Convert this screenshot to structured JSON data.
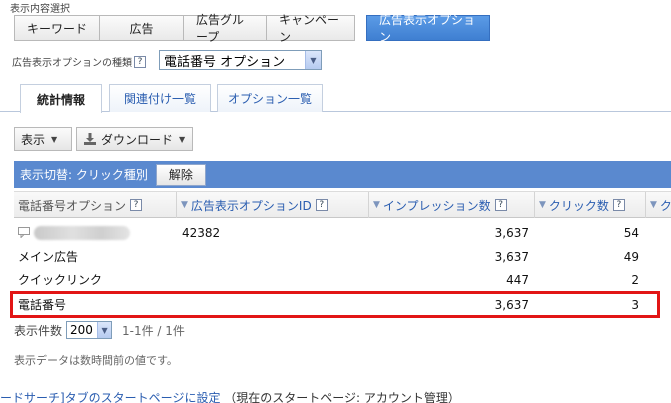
{
  "section_label": "表示内容選択",
  "segments": [
    {
      "label": "キーワード"
    },
    {
      "label": "広告"
    },
    {
      "label": "広告グループ"
    },
    {
      "label": "キャンペーン"
    },
    {
      "label": "広告表示オプション",
      "active": true
    }
  ],
  "type_selector": {
    "label": "広告表示オプションの種類",
    "help": "?",
    "value": "電話番号 オプション"
  },
  "tabs": [
    {
      "label": "統計情報",
      "active": true
    },
    {
      "label": "関連付け一覧"
    },
    {
      "label": "オプション一覧"
    }
  ],
  "toolbar": {
    "view_label": "表示",
    "download_label": "ダウンロード"
  },
  "filter_bar": {
    "label": "表示切替: クリック種別",
    "clear_label": "解除"
  },
  "table": {
    "columns": [
      {
        "label": "電話番号オプション",
        "help": "?"
      },
      {
        "label": "広告表示オプションID",
        "help": "?"
      },
      {
        "label": "インプレッション数",
        "help": "?"
      },
      {
        "label": "クリック数",
        "help": "?"
      },
      {
        "label": "ク"
      }
    ],
    "rows": [
      {
        "name": "",
        "id": "42382",
        "impressions": "3,637",
        "clicks": "54"
      },
      {
        "name": "メイン広告",
        "id": "",
        "impressions": "3,637",
        "clicks": "49"
      },
      {
        "name": "クイックリンク",
        "id": "",
        "impressions": "447",
        "clicks": "2"
      },
      {
        "name": "電話番号",
        "id": "",
        "impressions": "3,637",
        "clicks": "3"
      }
    ]
  },
  "pager": {
    "label": "表示件数",
    "value": "200",
    "count": "1-1件 / 1件"
  },
  "note": "表示データは数時間前の値です。",
  "footer": {
    "link": "ードサーチ]タブのスタートページに設定",
    "rest": "（現在のスタートページ: アカウント管理）"
  },
  "colors": {
    "accent_blue": "#4a87d6",
    "filter_bar": "#5a89cf",
    "highlight_red": "#e21515",
    "link": "#2a5db0"
  }
}
